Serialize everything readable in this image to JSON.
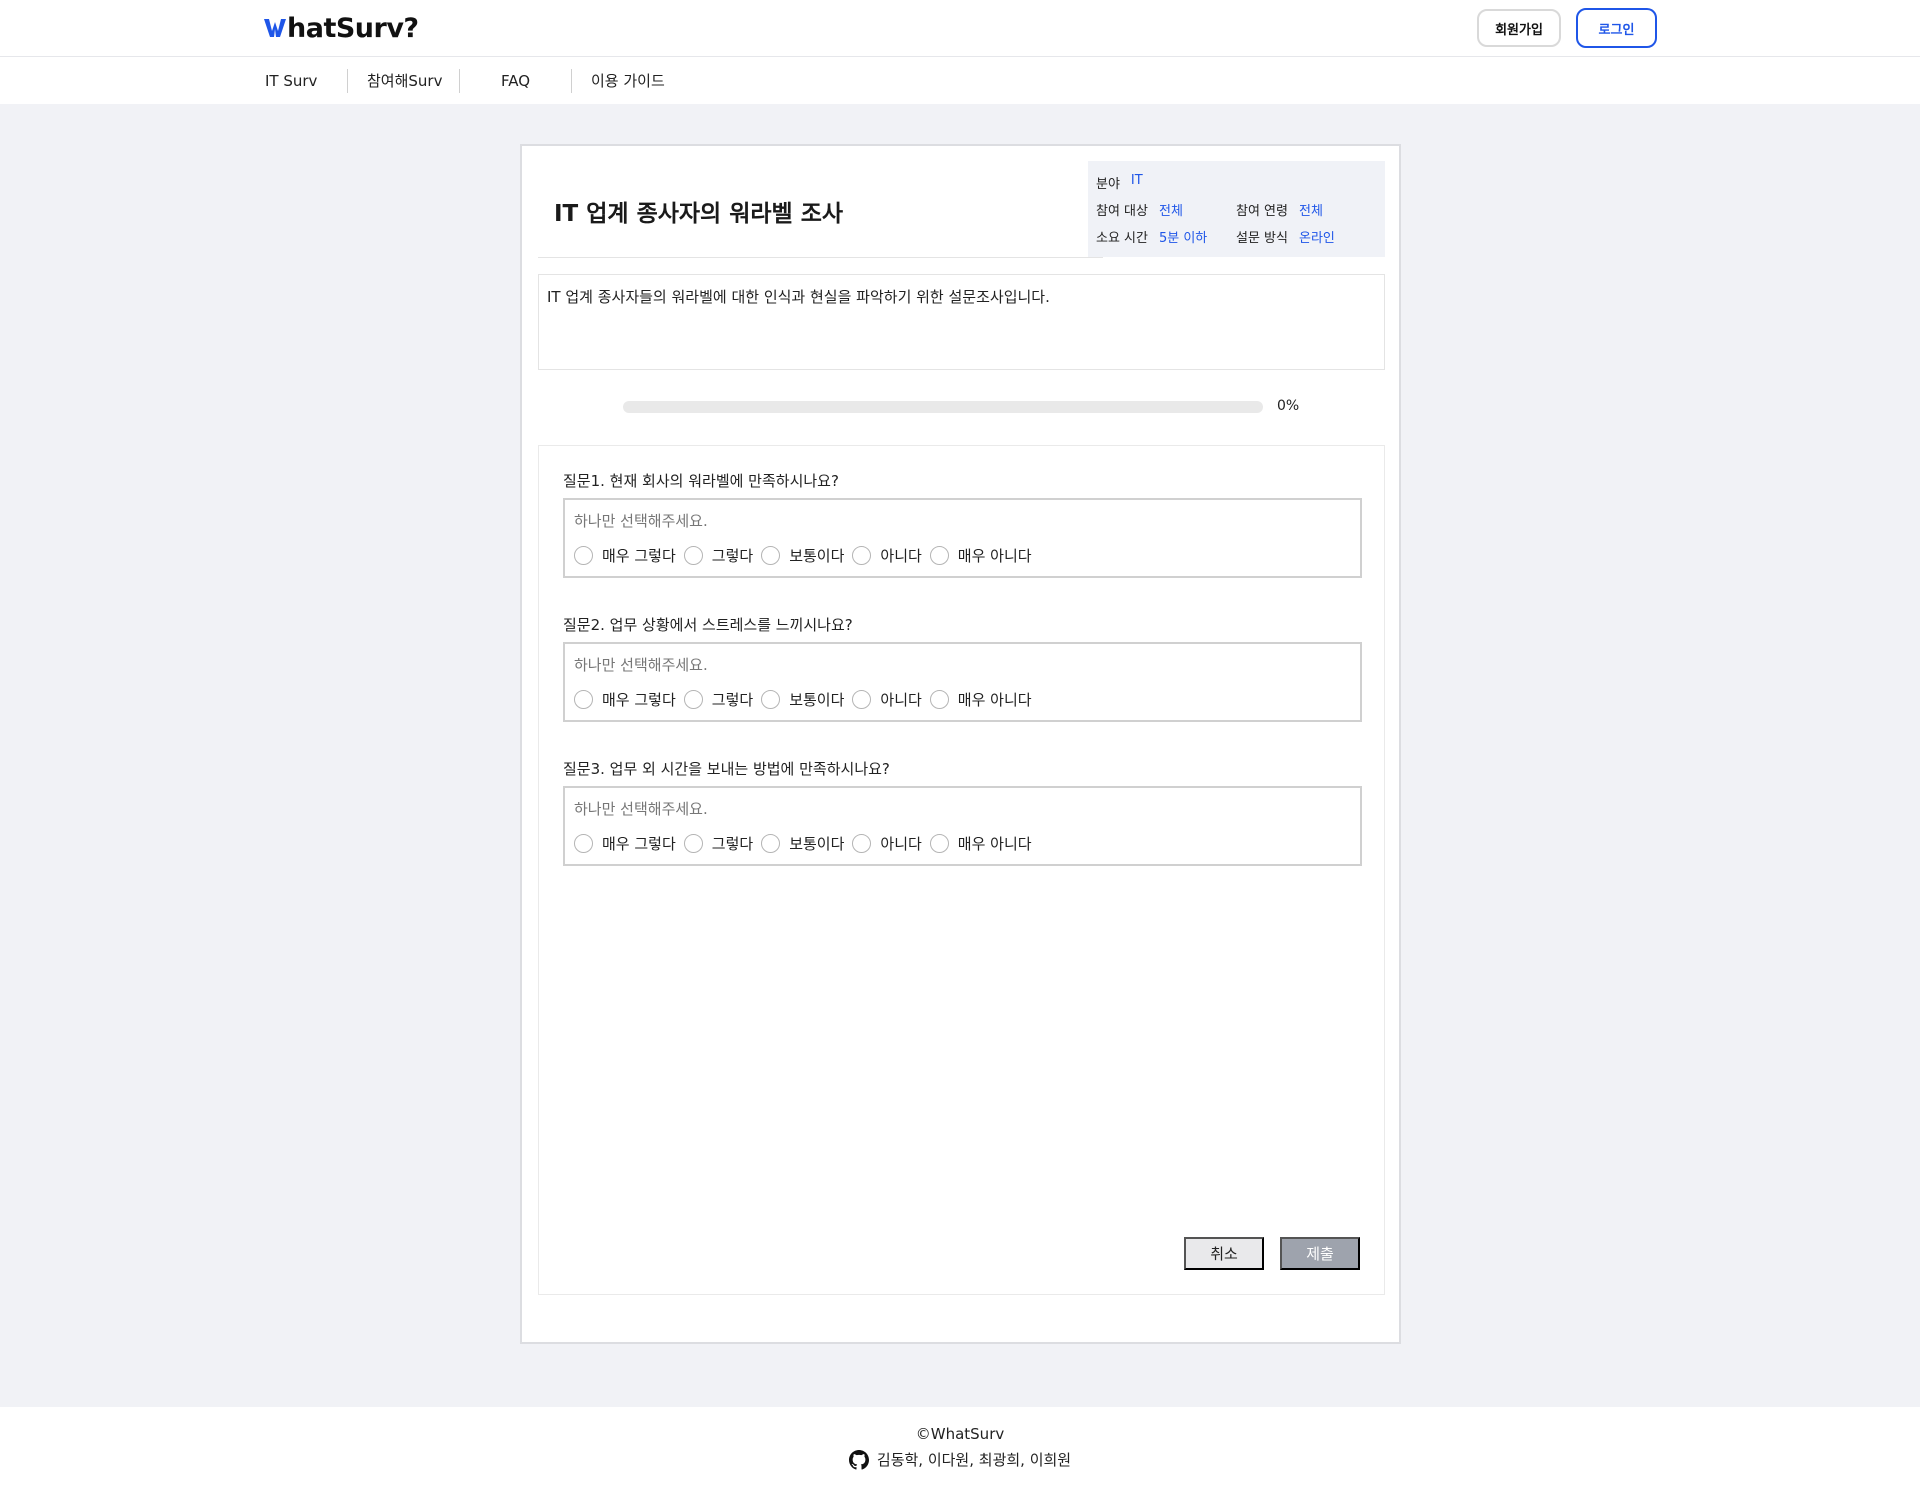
{
  "header": {
    "logo": "WhatSurv?",
    "signup_label": "회원가입",
    "login_label": "로그인",
    "brand_color": "#1f56e8"
  },
  "nav": {
    "items": [
      {
        "label": "IT Surv"
      },
      {
        "label": "참여해Surv"
      },
      {
        "label": "FAQ"
      },
      {
        "label": "이용 가이드"
      }
    ]
  },
  "survey": {
    "title": "IT 업계 종사자의 워라벨 조사",
    "meta": {
      "field_label": "분야",
      "field_value": "IT",
      "target_label": "참여 대상",
      "target_value": "전체",
      "age_label": "참여 연령",
      "age_value": "전체",
      "time_label": "소요 시간",
      "time_value": "5분 이하",
      "method_label": "설문 방식",
      "method_value": "온라인"
    },
    "description": "IT 업계 종사자들의 워라벨에 대한 인식과 현실을 파악하기 위한 설문조사입니다.",
    "progress_percent": 0,
    "progress_text": "0%",
    "questions": [
      {
        "title": "질문1. 현재 회사의 워라벨에 만족하시나요?",
        "hint": "하나만 선택해주세요.",
        "options": [
          "매우 그렇다",
          "그렇다",
          "보통이다",
          "아니다",
          "매우 아니다"
        ]
      },
      {
        "title": "질문2. 업무 상황에서 스트레스를 느끼시나요?",
        "hint": "하나만 선택해주세요.",
        "options": [
          "매우 그렇다",
          "그렇다",
          "보통이다",
          "아니다",
          "매우 아니다"
        ]
      },
      {
        "title": "질문3. 업무 외 시간을 보내는 방법에 만족하시나요?",
        "hint": "하나만 선택해주세요.",
        "options": [
          "매우 그렇다",
          "그렇다",
          "보통이다",
          "아니다",
          "매우 아니다"
        ]
      }
    ],
    "cancel_label": "취소",
    "submit_label": "제출"
  },
  "footer": {
    "copyright": "©WhatSurv",
    "authors": "김동학, 이다원, 최광희, 이희원",
    "icon": "github-icon"
  }
}
